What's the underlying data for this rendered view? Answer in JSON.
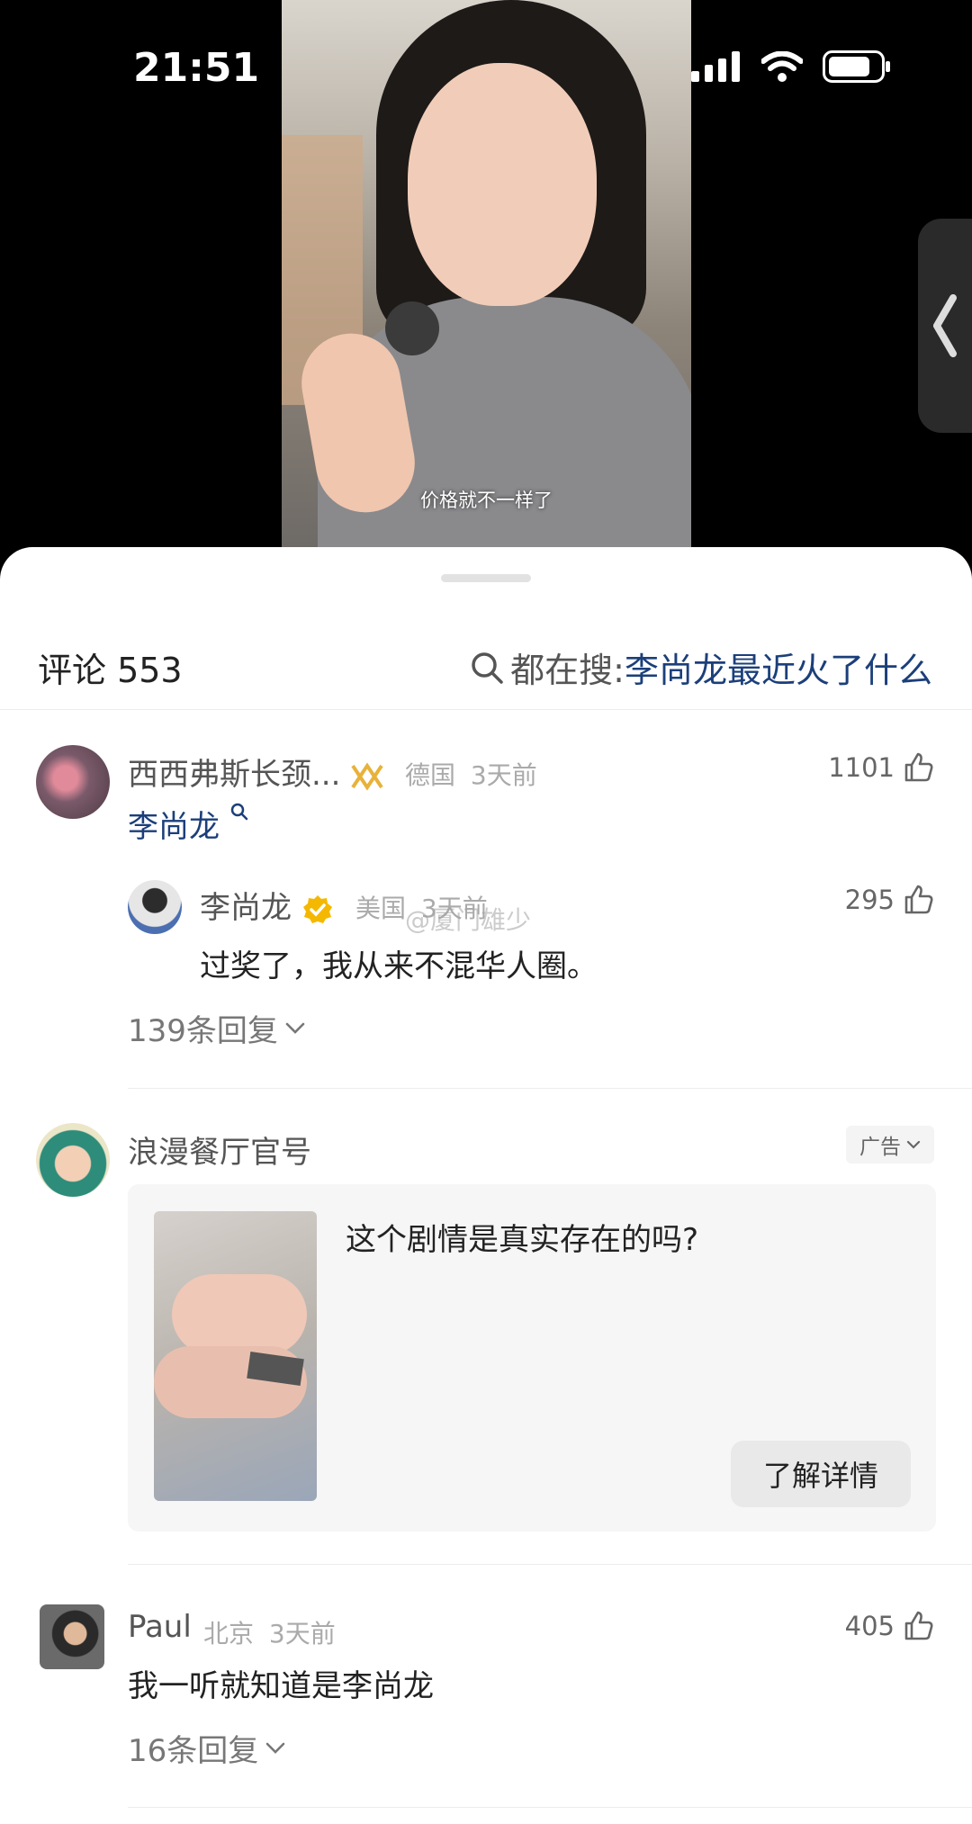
{
  "status_bar": {
    "time": "21:51"
  },
  "video": {
    "subtitle": "价格就不一样了"
  },
  "header": {
    "title": "评论 553",
    "search_prefix": "都在搜:",
    "search_term": "李尚龙最近火了什么"
  },
  "comments": [
    {
      "name": "西西弗斯长颈...",
      "location": "德国",
      "time": "3天前",
      "likes": "1101",
      "text": "李尚龙",
      "reply": {
        "name": "李尚龙",
        "location": "美国",
        "time": "3天前",
        "likes": "295",
        "text": "过奖了，我从来不混华人圈。"
      },
      "replies_label": "139条回复"
    },
    {
      "name": "浪漫餐厅官号",
      "ad_label": "广告",
      "ad_text": "这个剧情是真实存在的吗?",
      "ad_button": "了解详情"
    },
    {
      "name": "Paul",
      "location": "北京",
      "time": "3天前",
      "likes": "405",
      "text": "我一听就知道是李尚龙",
      "replies_label": "16条回复"
    }
  ],
  "watermark": "@厦门雄少"
}
